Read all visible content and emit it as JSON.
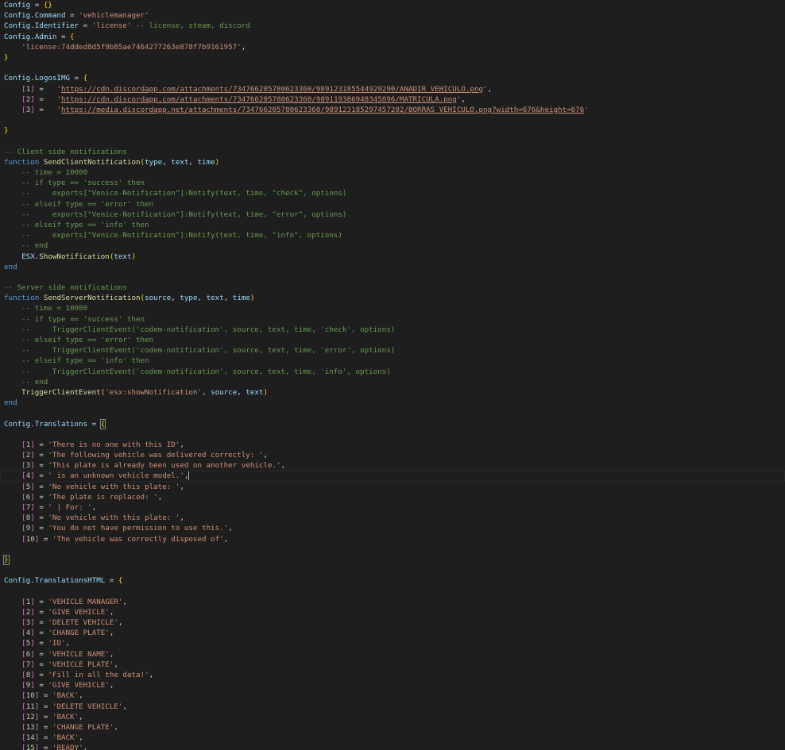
{
  "editor": {
    "language": "lua",
    "theme": "dark",
    "lines": [
      [
        [
          "var",
          "Config"
        ],
        [
          "op",
          " = "
        ],
        [
          "br1",
          "{}"
        ]
      ],
      [
        [
          "var",
          "Config"
        ],
        [
          "op",
          "."
        ],
        [
          "var",
          "Command"
        ],
        [
          "op",
          " = "
        ],
        [
          "str",
          "'vehiclemanager'"
        ]
      ],
      [
        [
          "var",
          "Config"
        ],
        [
          "op",
          "."
        ],
        [
          "var",
          "Identifier"
        ],
        [
          "op",
          " = "
        ],
        [
          "str",
          "'license'"
        ],
        [
          "com",
          " -- license, steam, discord"
        ]
      ],
      [
        [
          "var",
          "Config"
        ],
        [
          "op",
          "."
        ],
        [
          "var",
          "Admin"
        ],
        [
          "op",
          " = "
        ],
        [
          "br1",
          "{"
        ]
      ],
      [
        [
          "op",
          "    "
        ],
        [
          "str",
          "'license:74dded8d5f9b85ae7464277263e878f7b9161957'"
        ],
        [
          "op",
          ","
        ]
      ],
      [
        [
          "br1",
          "}"
        ]
      ],
      [],
      [
        [
          "var",
          "Config"
        ],
        [
          "op",
          "."
        ],
        [
          "var",
          "LogosIMG"
        ],
        [
          "op",
          " = "
        ],
        [
          "br1",
          "{"
        ]
      ],
      [
        [
          "op",
          "    "
        ],
        [
          "br2",
          "["
        ],
        [
          "num",
          "1"
        ],
        [
          "br2",
          "]"
        ],
        [
          "op",
          " =   "
        ],
        [
          "str",
          "'"
        ],
        [
          "url",
          "https://cdn.discordapp.com/attachments/734766205780623360/989123185544929290/ANADIR_VEHICULO.png"
        ],
        [
          "str",
          "'"
        ],
        [
          "op",
          ","
        ]
      ],
      [
        [
          "op",
          "    "
        ],
        [
          "br2",
          "["
        ],
        [
          "num",
          "2"
        ],
        [
          "br2",
          "]"
        ],
        [
          "op",
          " =   "
        ],
        [
          "str",
          "'"
        ],
        [
          "url",
          "https://cdn.discordapp.com/attachments/734766205780623360/989119386948345896/MATRICULA.png"
        ],
        [
          "str",
          "'"
        ],
        [
          "op",
          ","
        ]
      ],
      [
        [
          "op",
          "    "
        ],
        [
          "br2",
          "["
        ],
        [
          "num",
          "3"
        ],
        [
          "br2",
          "]"
        ],
        [
          "op",
          " =   "
        ],
        [
          "str",
          "'"
        ],
        [
          "url",
          "https://media.discordapp.net/attachments/734766205780623360/989123185297457202/BORRAS_VEHICULO.png?width=676&height=676"
        ],
        [
          "str",
          "'"
        ]
      ],
      [],
      [
        [
          "br1",
          "}"
        ]
      ],
      [],
      [
        [
          "com",
          "-- Client side notifications"
        ]
      ],
      [
        [
          "kw",
          "function"
        ],
        [
          "op",
          " "
        ],
        [
          "fn",
          "SendClientNotification"
        ],
        [
          "br1",
          "("
        ],
        [
          "var",
          "type"
        ],
        [
          "op",
          ", "
        ],
        [
          "var",
          "text"
        ],
        [
          "op",
          ", "
        ],
        [
          "var",
          "time"
        ],
        [
          "br1",
          ")"
        ]
      ],
      [
        [
          "op",
          "    "
        ],
        [
          "com",
          "-- time = 10000"
        ]
      ],
      [
        [
          "op",
          "    "
        ],
        [
          "com",
          "-- if type == 'success' then"
        ]
      ],
      [
        [
          "op",
          "    "
        ],
        [
          "com",
          "--     exports[\"Venice-Notification\"]:Notify(text, time, \"check\", options)"
        ]
      ],
      [
        [
          "op",
          "    "
        ],
        [
          "com",
          "-- elseif type == 'error' then"
        ]
      ],
      [
        [
          "op",
          "    "
        ],
        [
          "com",
          "--     exports[\"Venice-Notification\"]:Notify(text, time, \"error\", options)"
        ]
      ],
      [
        [
          "op",
          "    "
        ],
        [
          "com",
          "-- elseif type == 'info' then"
        ]
      ],
      [
        [
          "op",
          "    "
        ],
        [
          "com",
          "--     exports[\"Venice-Notification\"]:Notify(text, time, \"info\", options)"
        ]
      ],
      [
        [
          "op",
          "    "
        ],
        [
          "com",
          "-- end"
        ]
      ],
      [
        [
          "op",
          "    "
        ],
        [
          "var",
          "ESX"
        ],
        [
          "op",
          "."
        ],
        [
          "fn",
          "ShowNotification"
        ],
        [
          "br1",
          "("
        ],
        [
          "var",
          "text"
        ],
        [
          "br1",
          ")"
        ]
      ],
      [
        [
          "kw",
          "end"
        ]
      ],
      [],
      [
        [
          "com",
          "-- Server side notifications"
        ]
      ],
      [
        [
          "kw",
          "function"
        ],
        [
          "op",
          " "
        ],
        [
          "fn",
          "SendServerNotification"
        ],
        [
          "br1",
          "("
        ],
        [
          "var",
          "source"
        ],
        [
          "op",
          ", "
        ],
        [
          "var",
          "type"
        ],
        [
          "op",
          ", "
        ],
        [
          "var",
          "text"
        ],
        [
          "op",
          ", "
        ],
        [
          "var",
          "time"
        ],
        [
          "br1",
          ")"
        ]
      ],
      [
        [
          "op",
          "    "
        ],
        [
          "com",
          "-- time = 10000"
        ]
      ],
      [
        [
          "op",
          "    "
        ],
        [
          "com",
          "-- if type == 'success' then"
        ]
      ],
      [
        [
          "op",
          "    "
        ],
        [
          "com",
          "--     TriggerClientEvent('codem-notification', source, text, time, 'check', options)"
        ]
      ],
      [
        [
          "op",
          "    "
        ],
        [
          "com",
          "-- elseif type == 'error' then"
        ]
      ],
      [
        [
          "op",
          "    "
        ],
        [
          "com",
          "--     TriggerClientEvent('codem-notification', source, text, time, 'error', options)"
        ]
      ],
      [
        [
          "op",
          "    "
        ],
        [
          "com",
          "-- elseif type == 'info' then"
        ]
      ],
      [
        [
          "op",
          "    "
        ],
        [
          "com",
          "--     TriggerClientEvent('codem-notification', source, text, time, 'info', options)"
        ]
      ],
      [
        [
          "op",
          "    "
        ],
        [
          "com",
          "-- end"
        ]
      ],
      [
        [
          "op",
          "    "
        ],
        [
          "fn",
          "TriggerClientEvent"
        ],
        [
          "br1",
          "("
        ],
        [
          "str",
          "'esx:showNotification'"
        ],
        [
          "op",
          ", "
        ],
        [
          "var",
          "source"
        ],
        [
          "op",
          ", "
        ],
        [
          "var",
          "text"
        ],
        [
          "br1",
          ")"
        ]
      ],
      [
        [
          "kw",
          "end"
        ]
      ],
      [],
      [
        [
          "var",
          "Config"
        ],
        [
          "op",
          "."
        ],
        [
          "var",
          "Translations"
        ],
        [
          "op",
          " = "
        ],
        [
          "brm",
          "{"
        ]
      ],
      [],
      [
        [
          "op",
          "    "
        ],
        [
          "br2",
          "["
        ],
        [
          "num",
          "1"
        ],
        [
          "br2",
          "]"
        ],
        [
          "op",
          " = "
        ],
        [
          "str",
          "'There is no one with this ID'"
        ],
        [
          "op",
          ","
        ]
      ],
      [
        [
          "op",
          "    "
        ],
        [
          "br2",
          "["
        ],
        [
          "num",
          "2"
        ],
        [
          "br2",
          "]"
        ],
        [
          "op",
          " = "
        ],
        [
          "str",
          "'The following vehicle was delivered correctly: '"
        ],
        [
          "op",
          ","
        ]
      ],
      [
        [
          "op",
          "    "
        ],
        [
          "br2",
          "["
        ],
        [
          "num",
          "3"
        ],
        [
          "br2",
          "]"
        ],
        [
          "op",
          " = "
        ],
        [
          "str",
          "'This plate is already been used on another vehicle.'"
        ],
        [
          "op",
          ","
        ]
      ],
      [
        [
          "op",
          "    "
        ],
        [
          "br2",
          "["
        ],
        [
          "num",
          "4"
        ],
        [
          "br2",
          "]"
        ],
        [
          "op",
          " = "
        ],
        [
          "str",
          "' is an unknown vehicle model.'"
        ],
        [
          "op",
          ","
        ],
        [
          "caret",
          ""
        ]
      ],
      [
        [
          "op",
          "    "
        ],
        [
          "br2",
          "["
        ],
        [
          "num",
          "5"
        ],
        [
          "br2",
          "]"
        ],
        [
          "op",
          " = "
        ],
        [
          "str",
          "'No vehicle with this plate: '"
        ],
        [
          "op",
          ","
        ]
      ],
      [
        [
          "op",
          "    "
        ],
        [
          "br2",
          "["
        ],
        [
          "num",
          "6"
        ],
        [
          "br2",
          "]"
        ],
        [
          "op",
          " = "
        ],
        [
          "str",
          "'The plate is replaced: '"
        ],
        [
          "op",
          ","
        ]
      ],
      [
        [
          "op",
          "    "
        ],
        [
          "br2",
          "["
        ],
        [
          "num",
          "7"
        ],
        [
          "br2",
          "]"
        ],
        [
          "op",
          " = "
        ],
        [
          "str",
          "' | For: '"
        ],
        [
          "op",
          ","
        ]
      ],
      [
        [
          "op",
          "    "
        ],
        [
          "br2",
          "["
        ],
        [
          "num",
          "8"
        ],
        [
          "br2",
          "]"
        ],
        [
          "op",
          " = "
        ],
        [
          "str",
          "'No vehicle with this plate: '"
        ],
        [
          "op",
          ","
        ]
      ],
      [
        [
          "op",
          "    "
        ],
        [
          "br2",
          "["
        ],
        [
          "num",
          "9"
        ],
        [
          "br2",
          "]"
        ],
        [
          "op",
          " = "
        ],
        [
          "str",
          "'You do not have permission to use this.'"
        ],
        [
          "op",
          ","
        ]
      ],
      [
        [
          "op",
          "    "
        ],
        [
          "br2",
          "["
        ],
        [
          "num",
          "10"
        ],
        [
          "br2",
          "]"
        ],
        [
          "op",
          " = "
        ],
        [
          "str",
          "'The vehicle was correctly disposed of'"
        ],
        [
          "op",
          ","
        ]
      ],
      [],
      [
        [
          "brm",
          "}"
        ]
      ],
      [],
      [
        [
          "var",
          "Config"
        ],
        [
          "op",
          "."
        ],
        [
          "var",
          "TranslationsHTML"
        ],
        [
          "op",
          " = "
        ],
        [
          "br1",
          "{"
        ]
      ],
      [],
      [
        [
          "op",
          "    "
        ],
        [
          "br2",
          "["
        ],
        [
          "num",
          "1"
        ],
        [
          "br2",
          "]"
        ],
        [
          "op",
          " = "
        ],
        [
          "str",
          "'VEHICLE MANAGER'"
        ],
        [
          "op",
          ","
        ]
      ],
      [
        [
          "op",
          "    "
        ],
        [
          "br2",
          "["
        ],
        [
          "num",
          "2"
        ],
        [
          "br2",
          "]"
        ],
        [
          "op",
          " = "
        ],
        [
          "str",
          "'GIVE VEHICLE'"
        ],
        [
          "op",
          ","
        ]
      ],
      [
        [
          "op",
          "    "
        ],
        [
          "br2",
          "["
        ],
        [
          "num",
          "3"
        ],
        [
          "br2",
          "]"
        ],
        [
          "op",
          " = "
        ],
        [
          "str",
          "'DELETE VEHICLE'"
        ],
        [
          "op",
          ","
        ]
      ],
      [
        [
          "op",
          "    "
        ],
        [
          "br2",
          "["
        ],
        [
          "num",
          "4"
        ],
        [
          "br2",
          "]"
        ],
        [
          "op",
          " = "
        ],
        [
          "str",
          "'CHANGE PLATE'"
        ],
        [
          "op",
          ","
        ]
      ],
      [
        [
          "op",
          "    "
        ],
        [
          "br2",
          "["
        ],
        [
          "num",
          "5"
        ],
        [
          "br2",
          "]"
        ],
        [
          "op",
          " = "
        ],
        [
          "str",
          "'ID'"
        ],
        [
          "op",
          ","
        ]
      ],
      [
        [
          "op",
          "    "
        ],
        [
          "br2",
          "["
        ],
        [
          "num",
          "6"
        ],
        [
          "br2",
          "]"
        ],
        [
          "op",
          " = "
        ],
        [
          "str",
          "'VEHICLE NAME'"
        ],
        [
          "op",
          ","
        ]
      ],
      [
        [
          "op",
          "    "
        ],
        [
          "br2",
          "["
        ],
        [
          "num",
          "7"
        ],
        [
          "br2",
          "]"
        ],
        [
          "op",
          " = "
        ],
        [
          "str",
          "'VEHICLE PLATE'"
        ],
        [
          "op",
          ","
        ]
      ],
      [
        [
          "op",
          "    "
        ],
        [
          "br2",
          "["
        ],
        [
          "num",
          "8"
        ],
        [
          "br2",
          "]"
        ],
        [
          "op",
          " = "
        ],
        [
          "str",
          "'Fill in all the data!'"
        ],
        [
          "op",
          ","
        ]
      ],
      [
        [
          "op",
          "    "
        ],
        [
          "br2",
          "["
        ],
        [
          "num",
          "9"
        ],
        [
          "br2",
          "]"
        ],
        [
          "op",
          " = "
        ],
        [
          "str",
          "'GIVE VEHICLE'"
        ],
        [
          "op",
          ","
        ]
      ],
      [
        [
          "op",
          "    "
        ],
        [
          "br2",
          "["
        ],
        [
          "num",
          "10"
        ],
        [
          "br2",
          "]"
        ],
        [
          "op",
          " = "
        ],
        [
          "str",
          "'BACK'"
        ],
        [
          "op",
          ","
        ]
      ],
      [
        [
          "op",
          "    "
        ],
        [
          "br2",
          "["
        ],
        [
          "num",
          "11"
        ],
        [
          "br2",
          "]"
        ],
        [
          "op",
          " = "
        ],
        [
          "str",
          "'DELETE VEHICLE'"
        ],
        [
          "op",
          ","
        ]
      ],
      [
        [
          "op",
          "    "
        ],
        [
          "br2",
          "["
        ],
        [
          "num",
          "12"
        ],
        [
          "br2",
          "]"
        ],
        [
          "op",
          " = "
        ],
        [
          "str",
          "'BACK'"
        ],
        [
          "op",
          ","
        ]
      ],
      [
        [
          "op",
          "    "
        ],
        [
          "br2",
          "["
        ],
        [
          "num",
          "13"
        ],
        [
          "br2",
          "]"
        ],
        [
          "op",
          " = "
        ],
        [
          "str",
          "'CHANGE PLATE'"
        ],
        [
          "op",
          ","
        ]
      ],
      [
        [
          "op",
          "    "
        ],
        [
          "br2",
          "["
        ],
        [
          "num",
          "14"
        ],
        [
          "br2",
          "]"
        ],
        [
          "op",
          " = "
        ],
        [
          "str",
          "'BACK'"
        ],
        [
          "op",
          ","
        ]
      ],
      [
        [
          "op",
          "    "
        ],
        [
          "br2",
          "["
        ],
        [
          "num",
          "15"
        ],
        [
          "br2",
          "]"
        ],
        [
          "op",
          " = "
        ],
        [
          "str",
          "'READY'"
        ],
        [
          "op",
          ","
        ]
      ]
    ],
    "cursor_line": 45,
    "colors": {
      "background": "#1e1e1e",
      "keyword": "#569cd6",
      "variable": "#9cdcfe",
      "function": "#dcdcaa",
      "string": "#ce9178",
      "number": "#b5cea8",
      "comment": "#6a9955",
      "bracket_level1": "#ffd700",
      "bracket_level2": "#da70d6"
    }
  }
}
